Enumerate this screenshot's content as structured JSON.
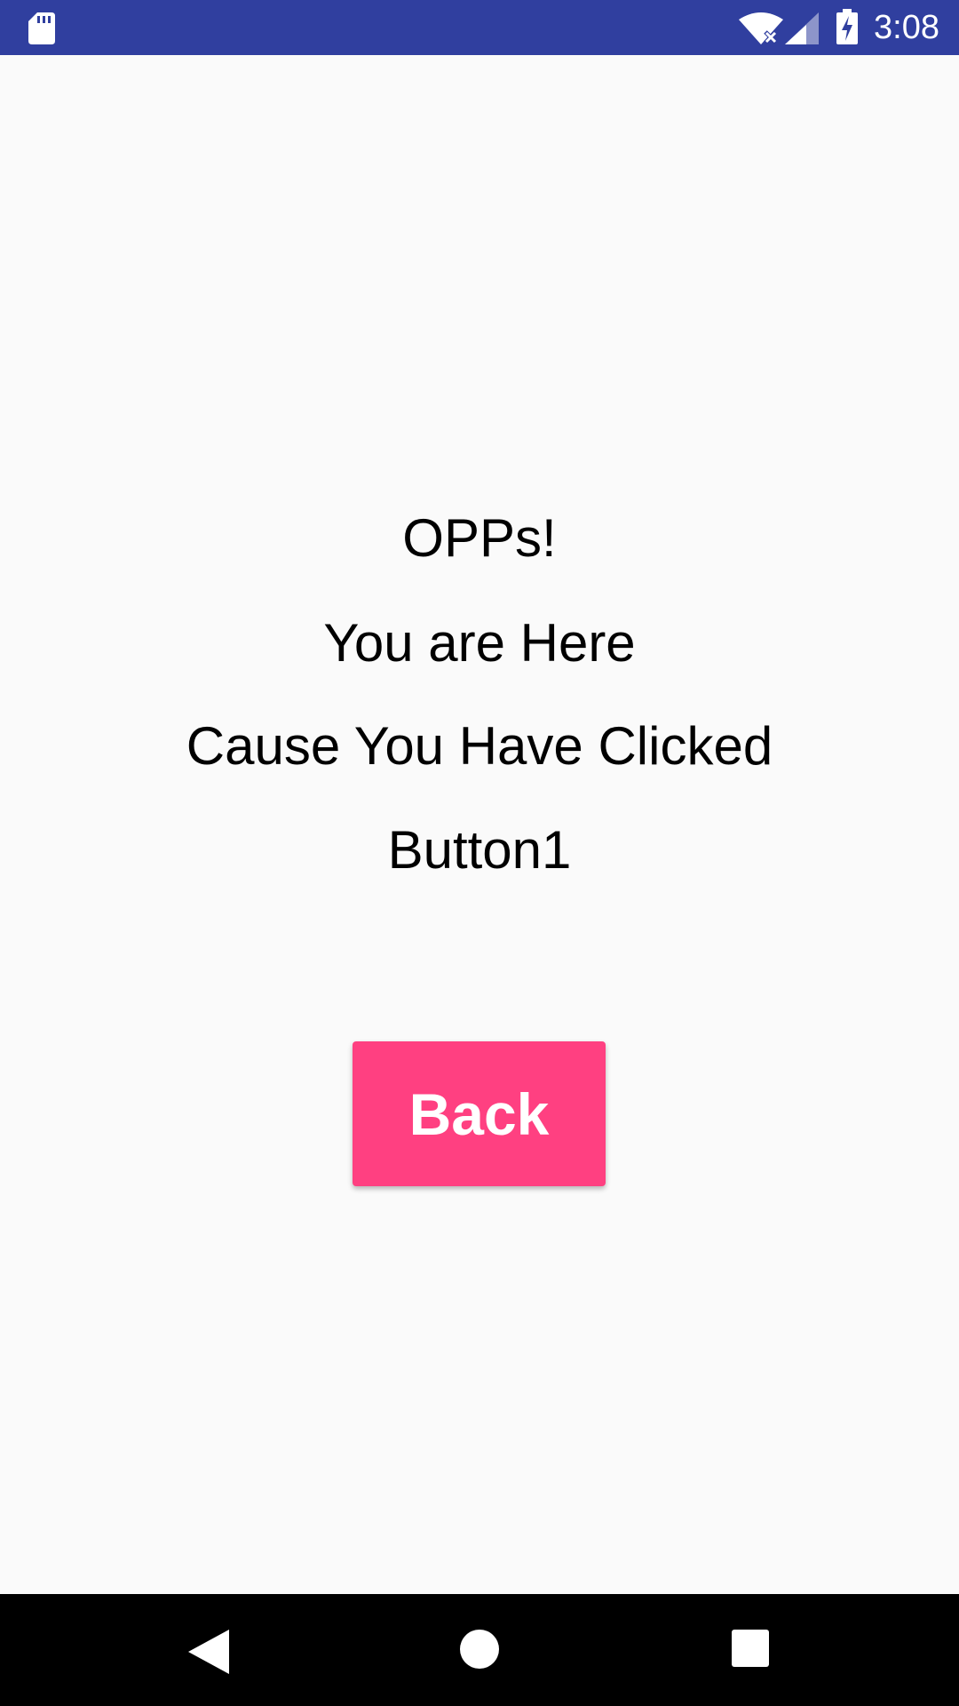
{
  "status_bar": {
    "time": "3:08",
    "background_color": "#303f9f",
    "icons": [
      "sd-card-icon",
      "wifi-icon",
      "signal-icon",
      "battery-charging-icon"
    ]
  },
  "main": {
    "lines": [
      "OPPs!",
      "You are Here",
      "Cause You Have Clicked",
      "Button1"
    ],
    "back_button_label": "Back",
    "accent_color": "#ff4081"
  },
  "nav_bar": {
    "icons": [
      "back-icon",
      "home-icon",
      "recents-icon"
    ]
  }
}
